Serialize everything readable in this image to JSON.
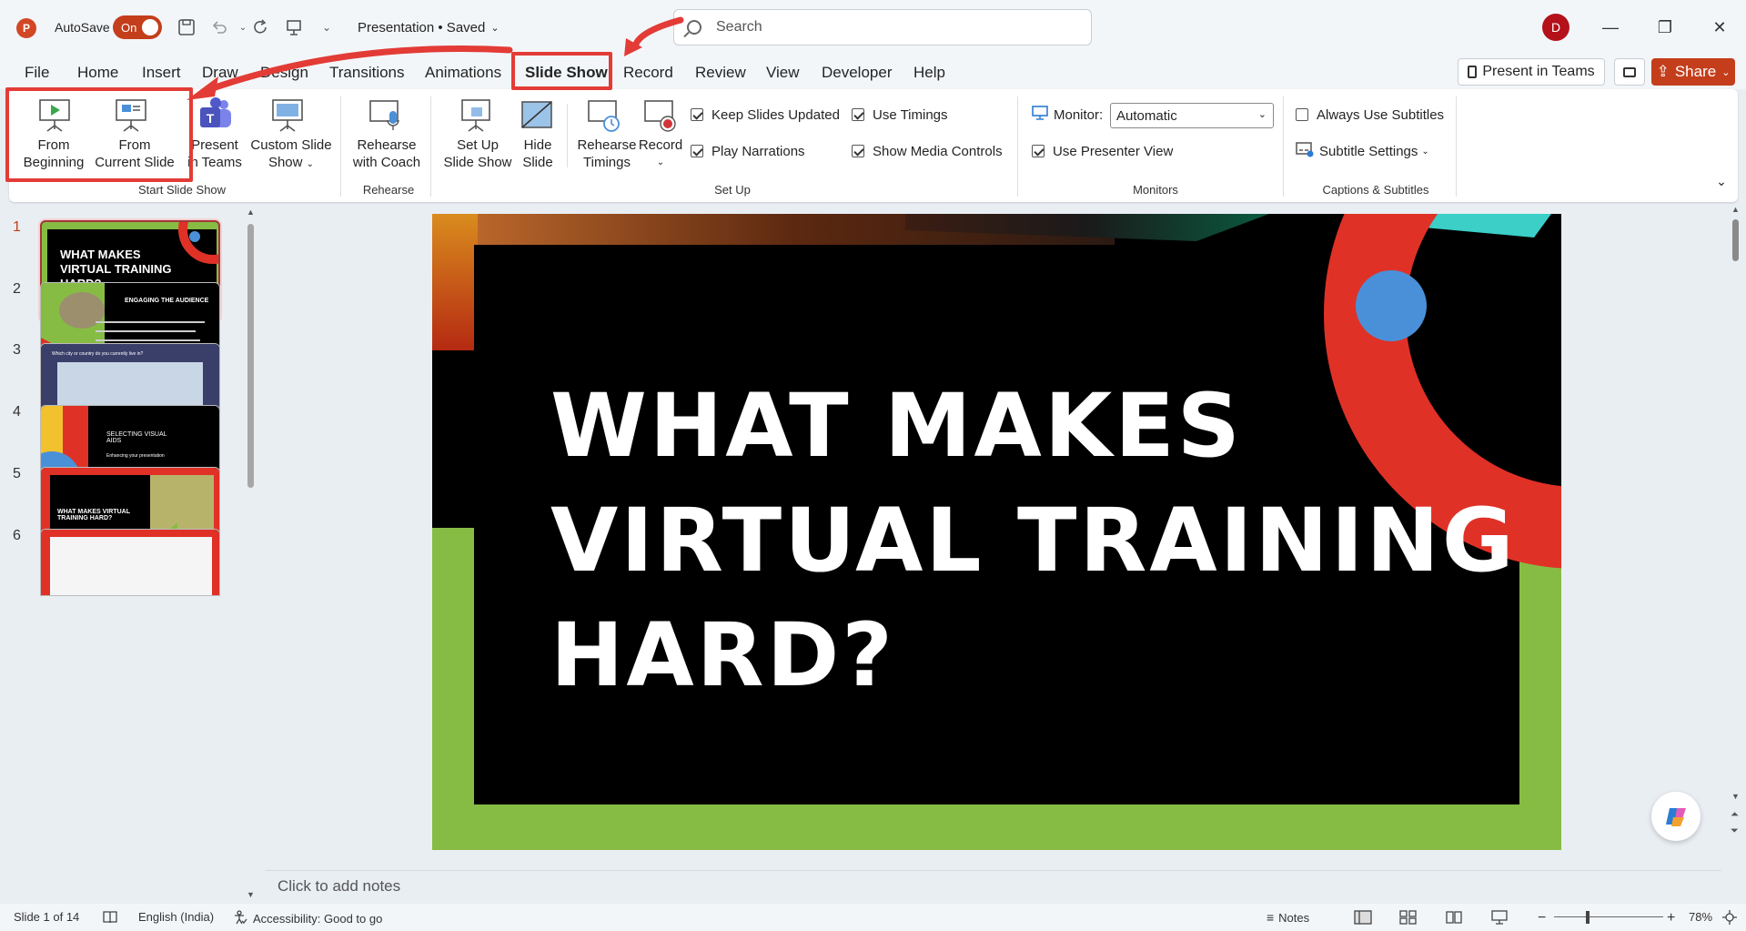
{
  "titlebar": {
    "autosave_label": "AutoSave",
    "autosave_state": "On",
    "doc_title": "Presentation • Saved",
    "search_placeholder": "Search",
    "user_initial": "D"
  },
  "tabs": [
    "File",
    "Home",
    "Insert",
    "Draw",
    "Design",
    "Transitions",
    "Animations",
    "Slide Show",
    "Record",
    "Review",
    "View",
    "Developer",
    "Help"
  ],
  "active_tab": "Slide Show",
  "header_buttons": {
    "present_in_teams": "Present in Teams",
    "share": "Share"
  },
  "ribbon": {
    "start": {
      "from_beginning_1": "From",
      "from_beginning_2": "Beginning",
      "from_current_1": "From",
      "from_current_2": "Current Slide",
      "present_teams_1": "Present",
      "present_teams_2": "in Teams",
      "custom_1": "Custom Slide",
      "custom_2": "Show",
      "label": "Start Slide Show"
    },
    "rehearse": {
      "coach_1": "Rehearse",
      "coach_2": "with Coach",
      "label": "Rehearse"
    },
    "setup": {
      "setup_1": "Set Up",
      "setup_2": "Slide Show",
      "hide_1": "Hide",
      "hide_2": "Slide",
      "timings_1": "Rehearse",
      "timings_2": "Timings",
      "record": "Record",
      "keep_updated": "Keep Slides Updated",
      "play_narrations": "Play Narrations",
      "use_timings": "Use Timings",
      "show_media": "Show Media Controls",
      "label": "Set Up"
    },
    "monitors": {
      "monitor_label": "Monitor:",
      "monitor_value": "Automatic",
      "presenter_view": "Use Presenter View",
      "label": "Monitors"
    },
    "captions": {
      "always_subtitles": "Always Use Subtitles",
      "subtitle_settings": "Subtitle Settings",
      "label": "Captions & Subtitles"
    }
  },
  "thumbnails": [
    {
      "num": "1",
      "title": "WHAT MAKES VIRTUAL TRAINING HARD?"
    },
    {
      "num": "2",
      "title": "ENGAGING THE AUDIENCE"
    },
    {
      "num": "3",
      "title": "Which city or country do you currently live in?"
    },
    {
      "num": "4",
      "title": "SELECTING VISUAL AIDS",
      "subtitle": "Enhancing your presentation"
    },
    {
      "num": "5",
      "title": "WHAT MAKES VIRTUAL TRAINING HARD?"
    },
    {
      "num": "6",
      "title": ""
    }
  ],
  "slide": {
    "title_line1": "WHAT MAKES",
    "title_line2": "VIRTUAL TRAINING",
    "title_line3": "HARD?"
  },
  "notes_placeholder": "Click to add notes",
  "status": {
    "slide_counter": "Slide 1 of 14",
    "language": "English (India)",
    "accessibility": "Accessibility: Good to go",
    "notes": "Notes",
    "zoom": "78%"
  },
  "colors": {
    "accent": "#c43e1c",
    "annotation": "#e33b36",
    "slide_green": "#86bc44",
    "slide_red": "#e03127",
    "slide_blue": "#4a90d9"
  }
}
